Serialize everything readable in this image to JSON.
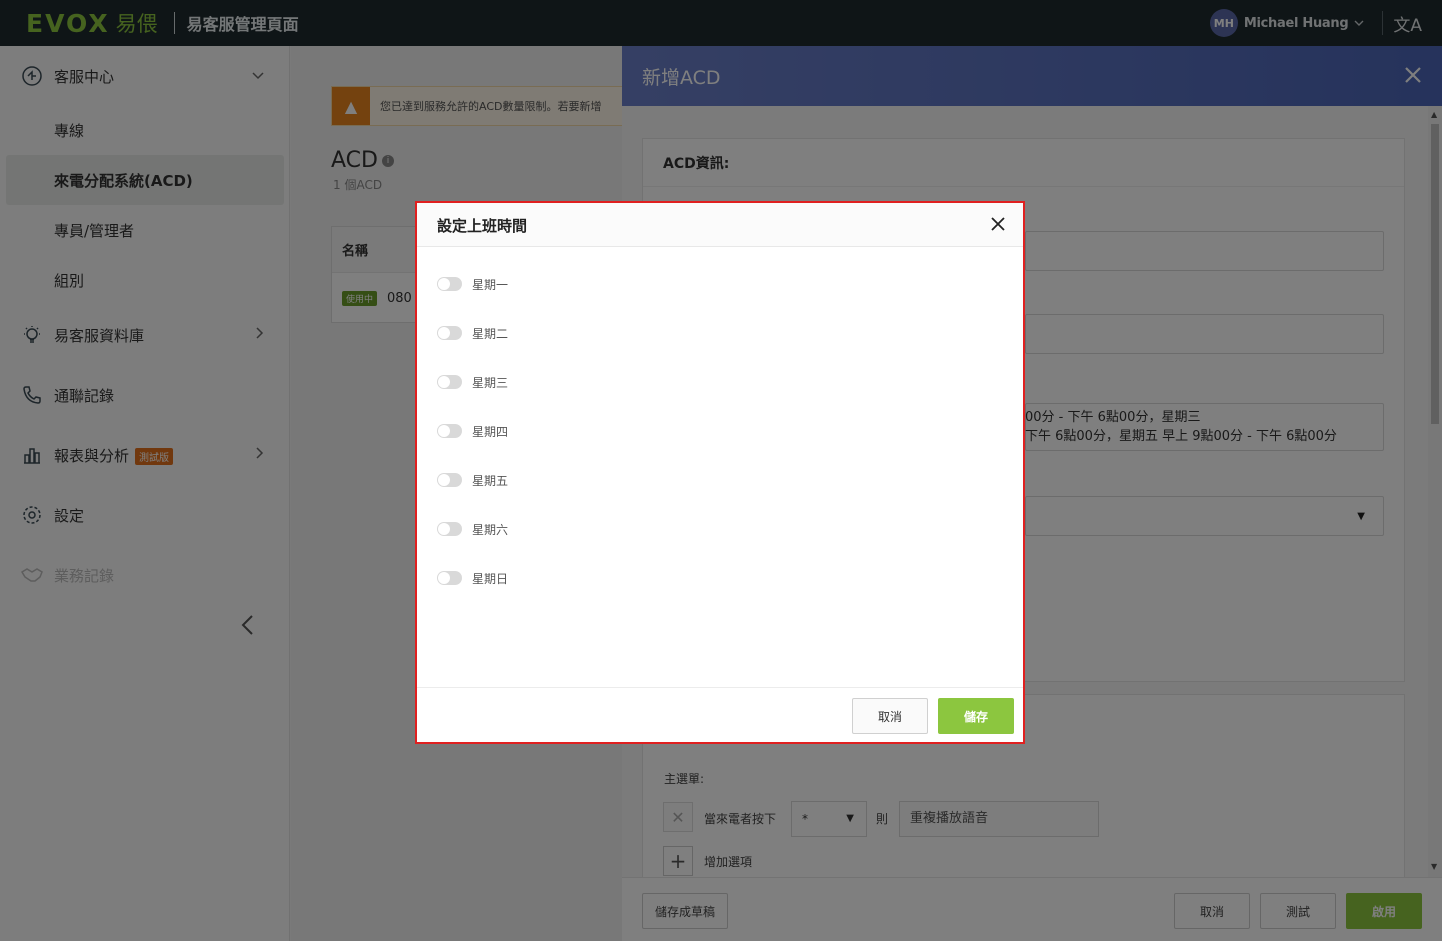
{
  "topbar": {
    "logo_text": "EVOX",
    "logo_cn": "易偎",
    "app_title": "易客服管理頁面",
    "user_initials": "MH",
    "user_name": "Michael Huang",
    "caret_icon": "chevron-down-icon",
    "lang_icon": "translate-icon"
  },
  "sidebar": {
    "items": [
      {
        "label": "客服中心",
        "icon": "headset-icon"
      },
      {
        "label": "專線"
      },
      {
        "label": "來電分配系統(ACD)"
      },
      {
        "label": "專員/管理者"
      },
      {
        "label": "組別"
      },
      {
        "label": "易客服資料庫",
        "icon": "lightbulb-icon"
      },
      {
        "label": "通聯記錄",
        "icon": "phone-icon"
      },
      {
        "label": "報表與分析",
        "icon": "bar-chart-icon",
        "badge": "測試版"
      },
      {
        "label": "設定",
        "icon": "gear-icon"
      },
      {
        "label": "業務記錄",
        "icon": "handshake-icon"
      }
    ]
  },
  "main": {
    "warning": "您已達到服務允許的ACD數量限制。若要新增",
    "title": "ACD",
    "count": "1 個ACD",
    "table_header": "名稱",
    "row_status": "使用中",
    "row_name": "080"
  },
  "drawer": {
    "title": "新增ACD",
    "section_title": "ACD資訊:",
    "work_time_line1": "00分 - 下午 6點00分，星期三",
    "work_time_line2": "下午 6點00分，星期五  早上 9點00分 - 下午 6點00分",
    "main_menu_label": "主選單:",
    "when_press": "當來電者按下",
    "key_value": "*",
    "then": "則",
    "action": "重複播放語音",
    "add_option": "增加選項",
    "save_draft": "儲存成草稿",
    "cancel": "取消",
    "test": "測試",
    "enable": "啟用"
  },
  "modal": {
    "title": "設定上班時間",
    "days": [
      "星期一",
      "星期二",
      "星期三",
      "星期四",
      "星期五",
      "星期六",
      "星期日"
    ],
    "cancel": "取消",
    "save": "儲存"
  },
  "colors": {
    "brand_green": "#8cc63f",
    "header_blue": "#5a6fc0",
    "topbar_bg": "#1f2a2e",
    "warn_orange": "#e8841e",
    "highlight_red": "#e02020"
  }
}
